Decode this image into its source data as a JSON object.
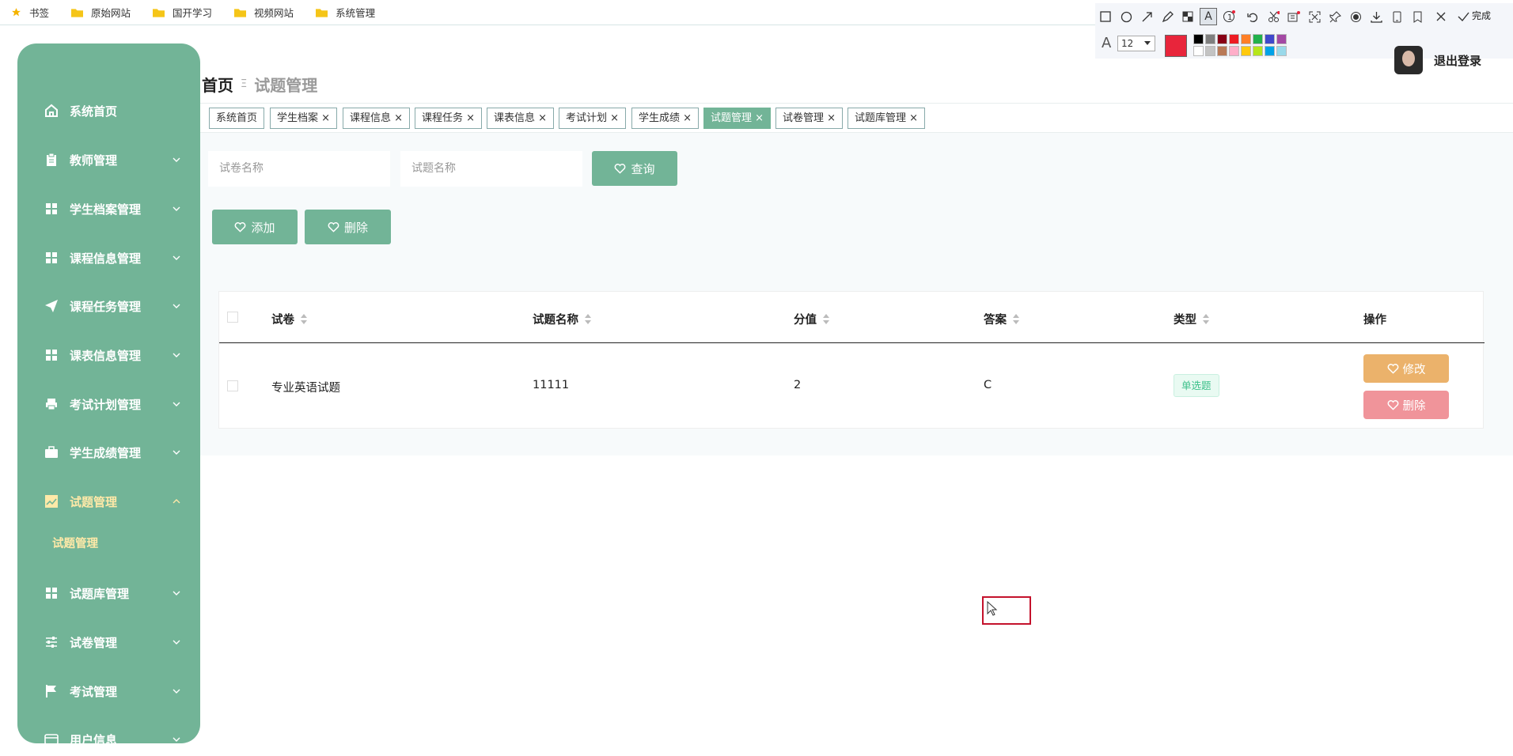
{
  "bookmarks": [
    {
      "label": "书签",
      "icon": "star-icon"
    },
    {
      "label": "原始网站",
      "icon": "folder-icon"
    },
    {
      "label": "国开学习",
      "icon": "folder-icon"
    },
    {
      "label": "视频网站",
      "icon": "folder-icon"
    },
    {
      "label": "系统管理",
      "icon": "folder-icon"
    }
  ],
  "sidebar": {
    "items": [
      {
        "label": "系统首页",
        "icon": "home-icon"
      },
      {
        "label": "教师管理",
        "icon": "clipboard-icon"
      },
      {
        "label": "学生档案管理",
        "icon": "grid-icon"
      },
      {
        "label": "课程信息管理",
        "icon": "grid-icon"
      },
      {
        "label": "课程任务管理",
        "icon": "send-icon"
      },
      {
        "label": "课表信息管理",
        "icon": "grid-icon"
      },
      {
        "label": "考试计划管理",
        "icon": "printer-icon"
      },
      {
        "label": "学生成绩管理",
        "icon": "briefcase-icon"
      },
      {
        "label": "试题管理",
        "icon": "chart-icon"
      },
      {
        "label": "试题库管理",
        "icon": "grid-icon"
      },
      {
        "label": "试卷管理",
        "icon": "sliders-icon"
      },
      {
        "label": "考试管理",
        "icon": "flag-icon"
      },
      {
        "label": "用户信息",
        "icon": "card-icon"
      }
    ],
    "sub_item": "试题管理"
  },
  "breadcrumb": {
    "home": "首页",
    "separator": "Ξ",
    "current": "试题管理"
  },
  "header": {
    "logout": "退出登录"
  },
  "screenshot_tool": {
    "font_size": "12",
    "done": "完成",
    "active_color": "#e8253b",
    "palette": [
      "#000000",
      "#7f7f7f",
      "#880015",
      "#ed1c24",
      "#ff7f27",
      "#22b14c",
      "#3f48cc",
      "#a349a4",
      "#ffffff",
      "#c3c3c3",
      "#b97a57",
      "#ffaec9",
      "#ffc90e",
      "#b5e61d",
      "#00a2e8",
      "#99d9ea"
    ]
  },
  "tabs": [
    "系统首页",
    "学生档案",
    "课程信息",
    "课程任务",
    "课表信息",
    "考试计划",
    "学生成绩",
    "试题管理",
    "试卷管理",
    "试题库管理"
  ],
  "active_tab": "试题管理",
  "search": {
    "placeholder1": "试卷名称",
    "placeholder2": "试题名称",
    "query_label": "查询"
  },
  "actions": {
    "add_label": "添加",
    "delete_label": "删除"
  },
  "table": {
    "columns": [
      "试卷",
      "试题名称",
      "分值",
      "答案",
      "类型",
      "操作"
    ],
    "rows": [
      {
        "paper": "专业英语试题",
        "name": "11111",
        "score": "2",
        "answer": "C",
        "type": "单选题",
        "edit": "修改",
        "delete": "删除"
      }
    ]
  },
  "colors": {
    "primary": "#72b497",
    "edit": "#ebb26b",
    "delete": "#f0949a",
    "tag": "#3cc08a"
  }
}
